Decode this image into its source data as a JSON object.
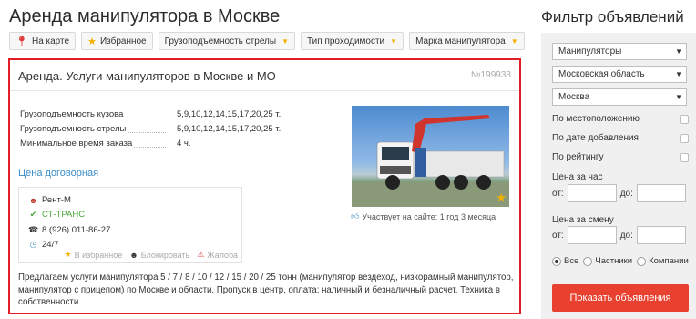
{
  "page_title": "Аренда манипулятора в Москве",
  "filter_title": "Фильтр объявлений",
  "chips": [
    {
      "label": "На карте"
    },
    {
      "label": "Избранное"
    },
    {
      "label": "Грузоподъемность стрелы"
    },
    {
      "label": "Тип проходимости"
    },
    {
      "label": "Марка манипулятора"
    }
  ],
  "listing": {
    "title": "Аренда. Услуги манипуляторов в Москве и МО",
    "id": "№199938",
    "specs": [
      {
        "label": "Грузоподъемность кузова",
        "value": "5,9,10,12,14,15,17,20,25 т."
      },
      {
        "label": "Грузоподъемность стрелы",
        "value": "5,9,10,12,14,15,17,20,25 т."
      },
      {
        "label": "Минимальное время заказа",
        "value": "4 ч."
      }
    ],
    "price": "Цена договорная",
    "contact": {
      "person": "Рент-М",
      "company": "СТ-ТРАНС",
      "phone": "8 (926) 011-86-27",
      "hours": "24/7"
    },
    "actions": {
      "favorite": "В избранное",
      "block": "Блокировать",
      "complain": "Жалоба"
    },
    "on_site": "Участвует на сайте: 1 год 3 месяца",
    "description": "Предлагаем услуги манипулятора 5 / 7 / 8 / 10 / 12 / 15 / 20 / 25 тонн (манипулятор вездеход, низкорамный манипулятор, манипулятор с прицепом) по Москве и области. Пропуск в центр, оплата: наличный и безналичный расчет. Техника в собственности."
  },
  "filter": {
    "selects": [
      "Манипуляторы",
      "Московская область",
      "Москва"
    ],
    "sort_options": [
      "По местоположению",
      "По дате добавления",
      "По рейтингу"
    ],
    "price_hour_label": "Цена за час",
    "price_shift_label": "Цена за смену",
    "from_label": "от:",
    "to_label": "до:",
    "radios": [
      {
        "label": "Все",
        "checked": true
      },
      {
        "label": "Частники",
        "checked": false
      },
      {
        "label": "Компании",
        "checked": false
      }
    ],
    "submit": "Показать объявления"
  },
  "colors": {
    "accent_red": "#e41e26",
    "button_red": "#e8412f",
    "link_blue": "#3b8ec9",
    "star_yellow": "#f2b100",
    "company_green": "#4aa43a"
  }
}
